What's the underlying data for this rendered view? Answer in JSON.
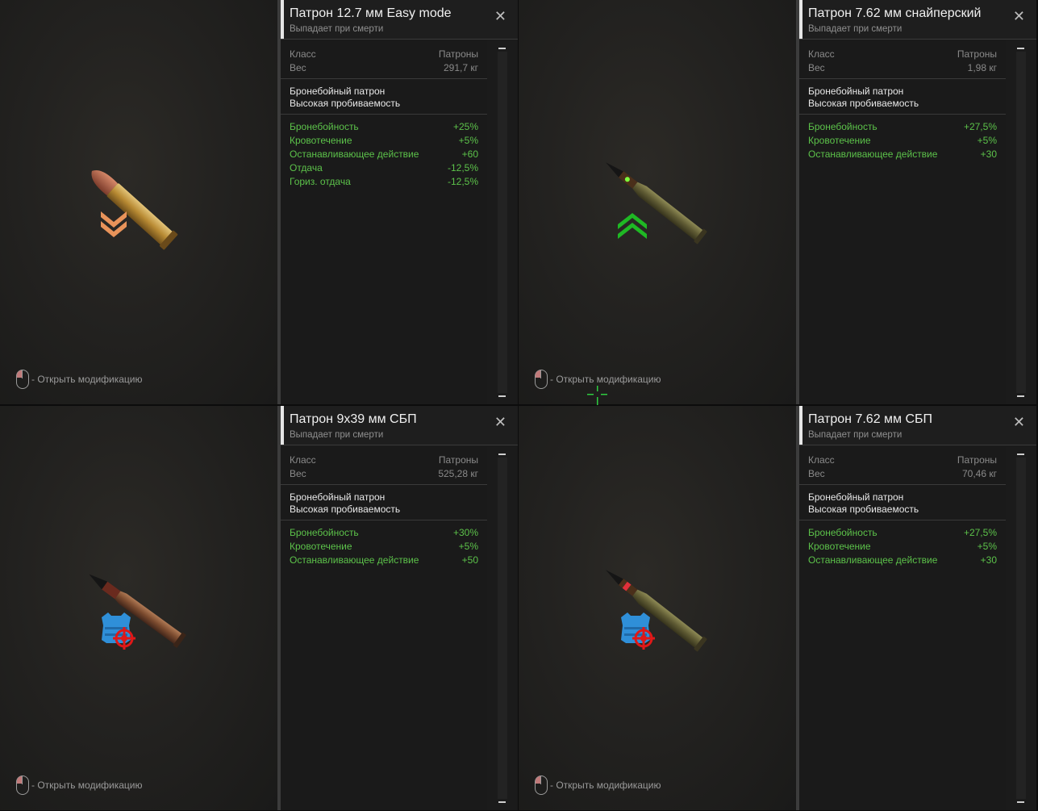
{
  "hint_text": "- Открыть модификацию",
  "label_class": "Класс",
  "label_weight": "Вес",
  "cards": [
    {
      "title": "Патрон 12.7 мм Easy mode",
      "subtitle": "Выпадает при смерти",
      "class_value": "Патроны",
      "weight_value": "291,7 кг",
      "desc1": "Бронебойный патрон",
      "desc2": "Высокая пробиваемость",
      "badge": "orange-double-chevron-down-icon",
      "stats": [
        {
          "name": "Бронебойность",
          "value": "+25%"
        },
        {
          "name": "Кровотечение",
          "value": "+5%"
        },
        {
          "name": "Останавливающее действие",
          "value": "+60"
        },
        {
          "name": "Отдача",
          "value": "-12,5%"
        },
        {
          "name": "Гориз. отдача",
          "value": "-12,5%"
        }
      ]
    },
    {
      "title": "Патрон 7.62 мм снайперский",
      "subtitle": "Выпадает при смерти",
      "class_value": "Патроны",
      "weight_value": "1,98 кг",
      "desc1": "Бронебойный патрон",
      "desc2": "Высокая пробиваемость",
      "badge": "green-double-chevron-up-icon",
      "stats": [
        {
          "name": "Бронебойность",
          "value": "+27,5%"
        },
        {
          "name": "Кровотечение",
          "value": "+5%"
        },
        {
          "name": "Останавливающее действие",
          "value": "+30"
        }
      ]
    },
    {
      "title": "Патрон 9x39 мм СБП",
      "subtitle": "Выпадает при смерти",
      "class_value": "Патроны",
      "weight_value": "525,28 кг",
      "desc1": "Бронебойный патрон",
      "desc2": "Высокая пробиваемость",
      "badge": "armor-vest-target-icon",
      "stats": [
        {
          "name": "Бронебойность",
          "value": "+30%"
        },
        {
          "name": "Кровотечение",
          "value": "+5%"
        },
        {
          "name": "Останавливающее действие",
          "value": "+50"
        }
      ]
    },
    {
      "title": "Патрон 7.62 мм СБП",
      "subtitle": "Выпадает при смерти",
      "class_value": "Патроны",
      "weight_value": "70,46 кг",
      "desc1": "Бронебойный патрон",
      "desc2": "Высокая пробиваемость",
      "badge": "armor-vest-target-icon",
      "stats": [
        {
          "name": "Бронебойность",
          "value": "+27,5%"
        },
        {
          "name": "Кровотечение",
          "value": "+5%"
        },
        {
          "name": "Останавливающее действие",
          "value": "+30"
        }
      ]
    }
  ],
  "colors": {
    "stat_green": "#5cc24a",
    "rarity_orange": "#e8935a",
    "upgrade_green": "#1fb824",
    "armor_blue": "#2f8fd8",
    "target_red": "#e01818"
  }
}
